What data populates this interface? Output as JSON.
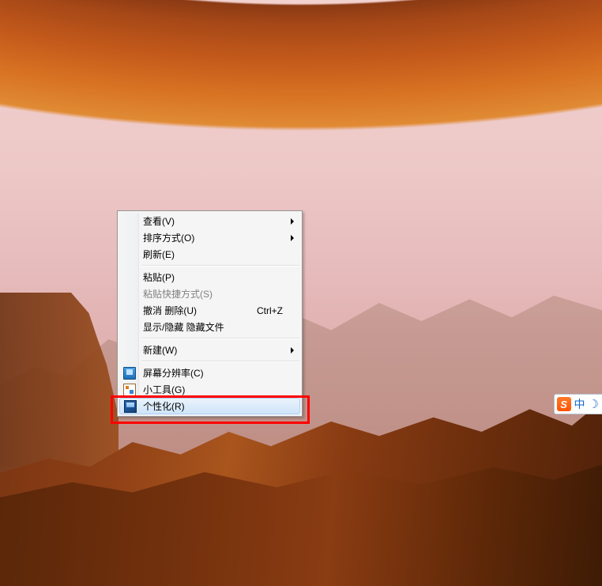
{
  "context_menu": {
    "items": [
      {
        "key": "view",
        "label": "查看(V)",
        "submenu": true
      },
      {
        "key": "sort",
        "label": "排序方式(O)",
        "submenu": true
      },
      {
        "key": "refresh",
        "label": "刷新(E)"
      },
      {
        "sep": true
      },
      {
        "key": "paste",
        "label": "粘贴(P)"
      },
      {
        "key": "paste-shortcut",
        "label": "粘贴快捷方式(S)",
        "disabled": true
      },
      {
        "key": "undo-delete",
        "label": "撤消 删除(U)",
        "shortcut": "Ctrl+Z"
      },
      {
        "key": "toggle-hidden",
        "label": "显示/隐藏 隐藏文件"
      },
      {
        "sep": true
      },
      {
        "key": "new",
        "label": "新建(W)",
        "submenu": true
      },
      {
        "sep": true
      },
      {
        "key": "resolution",
        "label": "屏幕分辨率(C)",
        "icon": "monitor"
      },
      {
        "key": "gadgets",
        "label": "小工具(G)",
        "icon": "gadget"
      },
      {
        "key": "personalize",
        "label": "个性化(R)",
        "icon": "pers",
        "highlighted": true
      }
    ]
  },
  "ime": {
    "logo_letter": "S",
    "mode": "中",
    "moon": "☽"
  },
  "annotation": {
    "highlight_target": "personalize"
  }
}
